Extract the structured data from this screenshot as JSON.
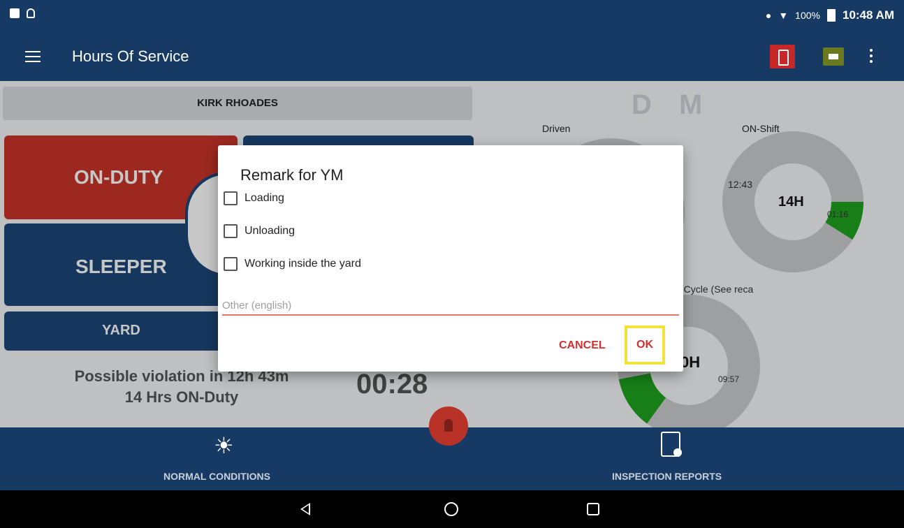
{
  "status_bar": {
    "battery": "100%",
    "time": "10:48 AM"
  },
  "app_bar": {
    "title": "Hours Of Service"
  },
  "main": {
    "driver_name": "KIRK RHOADES",
    "buttons": {
      "on_duty": "ON-DUTY",
      "sleeper": "SLEEPER",
      "yard": "YARD"
    },
    "violation": {
      "line1": "Possible violation in 12h 43m",
      "line2": "14 Hrs ON-Duty"
    },
    "timer": "00:28",
    "dm_label": "D M",
    "driven_label": "Driven",
    "onshift": {
      "label": "ON-Shift",
      "remaining": "12:43",
      "total": "14H",
      "used": "01:16",
      "used_fraction": 0.09
    },
    "cycle": {
      "label": "-Cycle (See reca",
      "total": "0H",
      "used": "09:57"
    }
  },
  "bottom_nav": {
    "normal_conditions": "NORMAL CONDITIONS",
    "inspection_reports": "INSPECTION REPORTS"
  },
  "dialog": {
    "title": "Remark for YM",
    "options": [
      {
        "label": "Loading",
        "checked": false
      },
      {
        "label": "Unloading",
        "checked": false
      },
      {
        "label": "Working inside the yard",
        "checked": false
      }
    ],
    "other": {
      "value": "",
      "placeholder": "Other (english)"
    },
    "cancel_label": "CANCEL",
    "ok_label": "OK"
  },
  "colors": {
    "primary": "#163a63",
    "on_duty": "#c8342a",
    "accent_red": "#d32f2f",
    "highlight": "#f2e23c",
    "donut_used": "#1fa21f"
  }
}
